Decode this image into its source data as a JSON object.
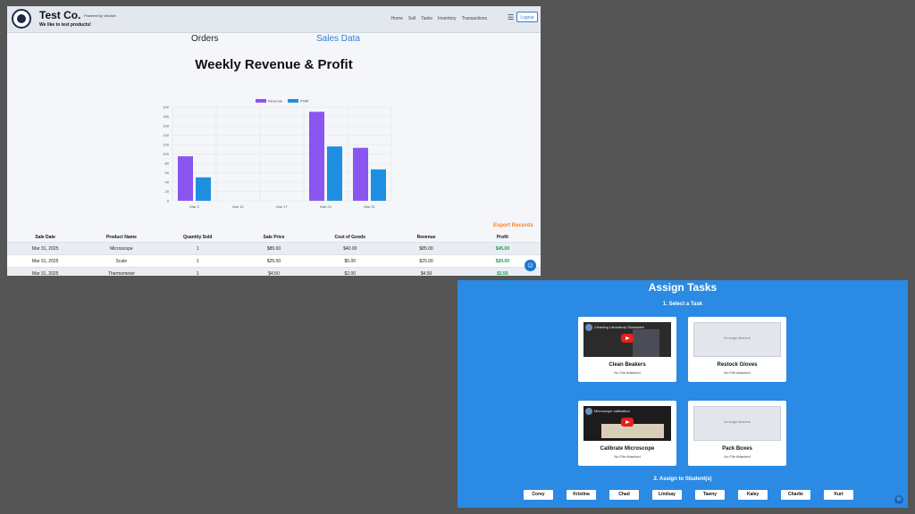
{
  "header": {
    "brand": "Test Co.",
    "powered_by": "Powered by Worklio",
    "tagline": "We like to test products!",
    "nav": [
      "Home",
      "Sell",
      "Tasks",
      "Inventory",
      "Transactions"
    ],
    "logout": "Logout"
  },
  "tabs": {
    "orders": "Orders",
    "sales": "Sales Data"
  },
  "export_label": "Export Records",
  "chart_data": {
    "type": "bar",
    "title": "Weekly Revenue & Profit",
    "categories": [
      "Mar 3",
      "Mar 10",
      "Mar 17",
      "Mar 24",
      "Mar 31"
    ],
    "series": [
      {
        "name": "Revenue",
        "values": [
          95,
          0,
          0,
          190,
          113
        ]
      },
      {
        "name": "Profit",
        "values": [
          50,
          0,
          0,
          116,
          67
        ]
      }
    ],
    "yticks": [
      "0",
      "20",
      "40",
      "60",
      "80",
      "100",
      "120",
      "140",
      "160",
      "180",
      "200"
    ],
    "ylim": [
      0,
      200
    ],
    "legend": "top",
    "grid": true,
    "colors": {
      "Revenue": "#8b55f0",
      "Profit": "#1e8fe0"
    }
  },
  "table": {
    "headers": [
      "Sale Date",
      "Product Name",
      "Quantity Sold",
      "Sale Price",
      "Cost of Goods",
      "Revenue",
      "Profit"
    ],
    "rows": [
      [
        "Mar 31, 2025",
        "Microscope",
        "1",
        "$85.00",
        "$40.00",
        "$85.00",
        "$45.00"
      ],
      [
        "Mar 31, 2025",
        "Scale",
        "1",
        "$25.00",
        "$5.00",
        "$25.00",
        "$20.00"
      ],
      [
        "Mar 31, 2025",
        "Thermometer",
        "1",
        "$4.50",
        "$2.00",
        "$4.50",
        "$2.50"
      ]
    ]
  },
  "assign": {
    "title": "Assign Tasks",
    "step1": "1. Select a Task",
    "step2": "2. Assign to Student(s)",
    "tasks": [
      {
        "title": "Clean Beakers",
        "sub": "No File Attached",
        "video_title": "Cleaning Laboratory Glassware"
      },
      {
        "title": "Restock Gloves",
        "sub": "No File Attached",
        "noimg": "No Image Attached"
      },
      {
        "title": "Calibrate Microscope",
        "sub": "No File Attached",
        "video_title": "Microscope calibration"
      },
      {
        "title": "Pack Boxes",
        "sub": "No File Attached",
        "noimg": "No Image Attached"
      }
    ],
    "students": [
      "Corey",
      "Kristina",
      "Chad",
      "Lindsay",
      "Tawny",
      "Kaley",
      "Charlie",
      "Kurt"
    ]
  }
}
